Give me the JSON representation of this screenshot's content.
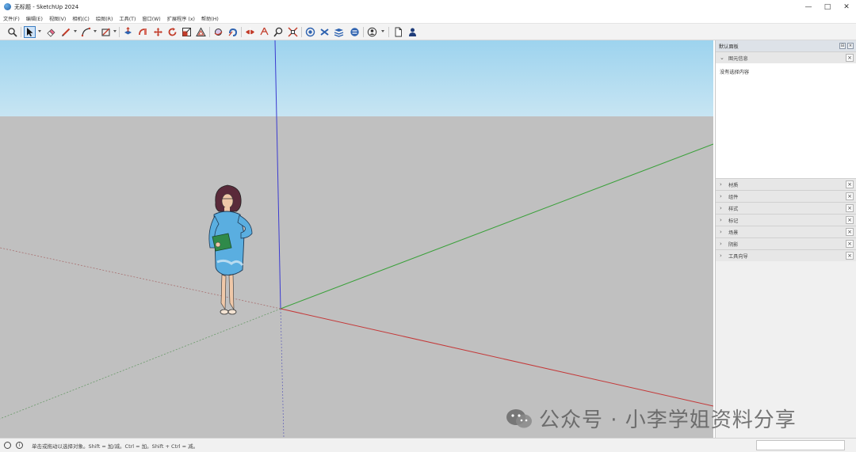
{
  "window": {
    "title": "无标题 - SketchUp 2024",
    "minimize_glyph": "—",
    "maximize_glyph": "□",
    "close_glyph": "✕"
  },
  "menu": {
    "items": [
      "文件(F)",
      "编辑(E)",
      "视图(V)",
      "相机(C)",
      "绘图(R)",
      "工具(T)",
      "窗口(W)",
      "扩展程序 (x)",
      "帮助(H)"
    ]
  },
  "toolbar": {
    "icons": [
      "search-icon",
      "select-arrow-icon",
      "eraser-icon",
      "pencil-icon",
      "arc-icon",
      "rectangle-icon",
      "push-pull-icon",
      "follow-me-icon",
      "move-icon",
      "rotate-icon",
      "scale-icon",
      "offset-icon",
      "orbit-icon",
      "pan-icon",
      "section-icon",
      "zoom-icon",
      "zoom-extents-icon",
      "3d-warehouse-icon",
      "extension-warehouse-icon",
      "layout-icon",
      "styles-icon",
      "account-icon",
      "document-icon",
      "user-icon"
    ]
  },
  "tray": {
    "title": "默认面板",
    "pin_glyph": "⊟",
    "close_glyph": "×",
    "entity_info": {
      "label": "图元信息",
      "empty_text": "没有选择内容"
    },
    "panels": [
      "材质",
      "组件",
      "样式",
      "标记",
      "场景",
      "阴影",
      "工具向导"
    ]
  },
  "statusbar": {
    "info_glyph": "i",
    "hint": "单击或拖动以选择对象。Shift = 加/减。Ctrl = 加。Shift + Ctrl = 减。"
  },
  "watermark": {
    "text": "公众号 · 小李学姐资料分享"
  },
  "colors": {
    "sky_top": "#9fd5ef",
    "sky_bottom": "#c2e3f3",
    "ground": "#c0c0c0",
    "axis_red": "#c43838",
    "axis_green": "#3aa03a",
    "axis_blue": "#3a3ad0",
    "dress": "#5aaee0"
  }
}
